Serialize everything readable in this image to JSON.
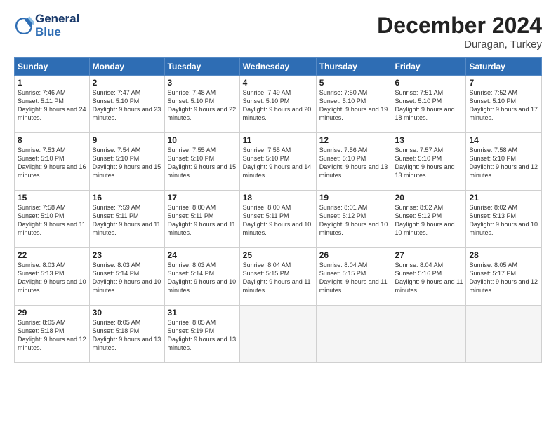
{
  "header": {
    "logo_line1": "General",
    "logo_line2": "Blue",
    "month_year": "December 2024",
    "location": "Duragan, Turkey"
  },
  "weekdays": [
    "Sunday",
    "Monday",
    "Tuesday",
    "Wednesday",
    "Thursday",
    "Friday",
    "Saturday"
  ],
  "weeks": [
    [
      {
        "day": "1",
        "sunrise": "7:46 AM",
        "sunset": "5:11 PM",
        "daylight": "9 hours and 24 minutes."
      },
      {
        "day": "2",
        "sunrise": "7:47 AM",
        "sunset": "5:10 PM",
        "daylight": "9 hours and 23 minutes."
      },
      {
        "day": "3",
        "sunrise": "7:48 AM",
        "sunset": "5:10 PM",
        "daylight": "9 hours and 22 minutes."
      },
      {
        "day": "4",
        "sunrise": "7:49 AM",
        "sunset": "5:10 PM",
        "daylight": "9 hours and 20 minutes."
      },
      {
        "day": "5",
        "sunrise": "7:50 AM",
        "sunset": "5:10 PM",
        "daylight": "9 hours and 19 minutes."
      },
      {
        "day": "6",
        "sunrise": "7:51 AM",
        "sunset": "5:10 PM",
        "daylight": "9 hours and 18 minutes."
      },
      {
        "day": "7",
        "sunrise": "7:52 AM",
        "sunset": "5:10 PM",
        "daylight": "9 hours and 17 minutes."
      }
    ],
    [
      {
        "day": "8",
        "sunrise": "7:53 AM",
        "sunset": "5:10 PM",
        "daylight": "9 hours and 16 minutes."
      },
      {
        "day": "9",
        "sunrise": "7:54 AM",
        "sunset": "5:10 PM",
        "daylight": "9 hours and 15 minutes."
      },
      {
        "day": "10",
        "sunrise": "7:55 AM",
        "sunset": "5:10 PM",
        "daylight": "9 hours and 15 minutes."
      },
      {
        "day": "11",
        "sunrise": "7:55 AM",
        "sunset": "5:10 PM",
        "daylight": "9 hours and 14 minutes."
      },
      {
        "day": "12",
        "sunrise": "7:56 AM",
        "sunset": "5:10 PM",
        "daylight": "9 hours and 13 minutes."
      },
      {
        "day": "13",
        "sunrise": "7:57 AM",
        "sunset": "5:10 PM",
        "daylight": "9 hours and 13 minutes."
      },
      {
        "day": "14",
        "sunrise": "7:58 AM",
        "sunset": "5:10 PM",
        "daylight": "9 hours and 12 minutes."
      }
    ],
    [
      {
        "day": "15",
        "sunrise": "7:58 AM",
        "sunset": "5:10 PM",
        "daylight": "9 hours and 11 minutes."
      },
      {
        "day": "16",
        "sunrise": "7:59 AM",
        "sunset": "5:11 PM",
        "daylight": "9 hours and 11 minutes."
      },
      {
        "day": "17",
        "sunrise": "8:00 AM",
        "sunset": "5:11 PM",
        "daylight": "9 hours and 11 minutes."
      },
      {
        "day": "18",
        "sunrise": "8:00 AM",
        "sunset": "5:11 PM",
        "daylight": "9 hours and 10 minutes."
      },
      {
        "day": "19",
        "sunrise": "8:01 AM",
        "sunset": "5:12 PM",
        "daylight": "9 hours and 10 minutes."
      },
      {
        "day": "20",
        "sunrise": "8:02 AM",
        "sunset": "5:12 PM",
        "daylight": "9 hours and 10 minutes."
      },
      {
        "day": "21",
        "sunrise": "8:02 AM",
        "sunset": "5:13 PM",
        "daylight": "9 hours and 10 minutes."
      }
    ],
    [
      {
        "day": "22",
        "sunrise": "8:03 AM",
        "sunset": "5:13 PM",
        "daylight": "9 hours and 10 minutes."
      },
      {
        "day": "23",
        "sunrise": "8:03 AM",
        "sunset": "5:14 PM",
        "daylight": "9 hours and 10 minutes."
      },
      {
        "day": "24",
        "sunrise": "8:03 AM",
        "sunset": "5:14 PM",
        "daylight": "9 hours and 10 minutes."
      },
      {
        "day": "25",
        "sunrise": "8:04 AM",
        "sunset": "5:15 PM",
        "daylight": "9 hours and 11 minutes."
      },
      {
        "day": "26",
        "sunrise": "8:04 AM",
        "sunset": "5:15 PM",
        "daylight": "9 hours and 11 minutes."
      },
      {
        "day": "27",
        "sunrise": "8:04 AM",
        "sunset": "5:16 PM",
        "daylight": "9 hours and 11 minutes."
      },
      {
        "day": "28",
        "sunrise": "8:05 AM",
        "sunset": "5:17 PM",
        "daylight": "9 hours and 12 minutes."
      }
    ],
    [
      {
        "day": "29",
        "sunrise": "8:05 AM",
        "sunset": "5:18 PM",
        "daylight": "9 hours and 12 minutes."
      },
      {
        "day": "30",
        "sunrise": "8:05 AM",
        "sunset": "5:18 PM",
        "daylight": "9 hours and 13 minutes."
      },
      {
        "day": "31",
        "sunrise": "8:05 AM",
        "sunset": "5:19 PM",
        "daylight": "9 hours and 13 minutes."
      },
      null,
      null,
      null,
      null
    ]
  ]
}
